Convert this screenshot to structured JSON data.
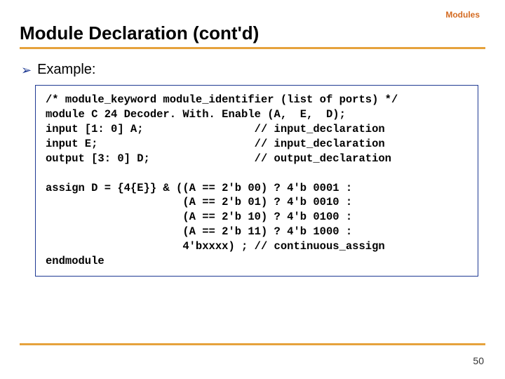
{
  "header": {
    "section_label": "Modules",
    "title": "Module Declaration (cont'd)"
  },
  "bullet": {
    "label": "Example:"
  },
  "code": {
    "l1": "/* module_keyword module_identifier (list of ports) */",
    "l2": "module C 24 Decoder. With. Enable (A,  E,  D);",
    "l3": "input [1: 0] A;                 // input_declaration",
    "l4": "input E;                        // input_declaration",
    "l5": "output [3: 0] D;                // output_declaration",
    "blank1": "",
    "l6": "assign D = {4{E}} & ((A == 2'b 00) ? 4'b 0001 :",
    "l7": "                     (A == 2'b 01) ? 4'b 0010 :",
    "l8": "                     (A == 2'b 10) ? 4'b 0100 :",
    "l9": "                     (A == 2'b 11) ? 4'b 1000 :",
    "l10": "                     4'bxxxx) ; // continuous_assign",
    "l11": "endmodule"
  },
  "footer": {
    "page": "50"
  }
}
